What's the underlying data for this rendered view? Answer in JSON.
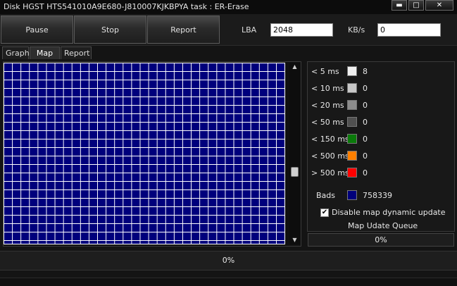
{
  "window": {
    "title": "Disk HGST HTS541010A9E680-J810007KJKBPYA  task : ER-Erase",
    "controls": {
      "minimize": "▬",
      "maximize": "□",
      "close": "✕"
    }
  },
  "toolbar": {
    "pause_label": "Pause",
    "stop_label": "Stop",
    "report_label": "Report",
    "lba_label": "LBA",
    "lba_value": "2048",
    "kbs_label": "KB/s",
    "kbs_value": "0"
  },
  "tabs": [
    {
      "label": "Graph",
      "active": false
    },
    {
      "label": "Map",
      "active": true
    },
    {
      "label": "Report",
      "active": false
    }
  ],
  "map": {
    "block_color": "#00007c",
    "grid_line_color": "#ffffff"
  },
  "legend": {
    "items": [
      {
        "label": "< 5 ms",
        "color": "#f0f0f0",
        "count": "8"
      },
      {
        "label": "< 10 ms",
        "color": "#c8c8c8",
        "count": "0"
      },
      {
        "label": "< 20 ms",
        "color": "#8c8c8c",
        "count": "0"
      },
      {
        "label": "< 50 ms",
        "color": "#505050",
        "count": "0"
      },
      {
        "label": "< 150 ms",
        "color": "#0a7a0a",
        "count": "0"
      },
      {
        "label": "< 500 ms",
        "color": "#ff8000",
        "count": "0"
      },
      {
        "label": "> 500 ms",
        "color": "#ff0000",
        "count": "0"
      }
    ],
    "bads": {
      "label": "Bads",
      "color": "#00007c",
      "count": "758339"
    },
    "disable_update": {
      "label": "Disable map dynamic update",
      "checked": true,
      "mark": "✔"
    },
    "queue_label": "Map Udate Queue"
  },
  "queue_progress": {
    "text": "0%",
    "value": 0
  },
  "overall_progress": {
    "text": "0%",
    "value": 0
  }
}
